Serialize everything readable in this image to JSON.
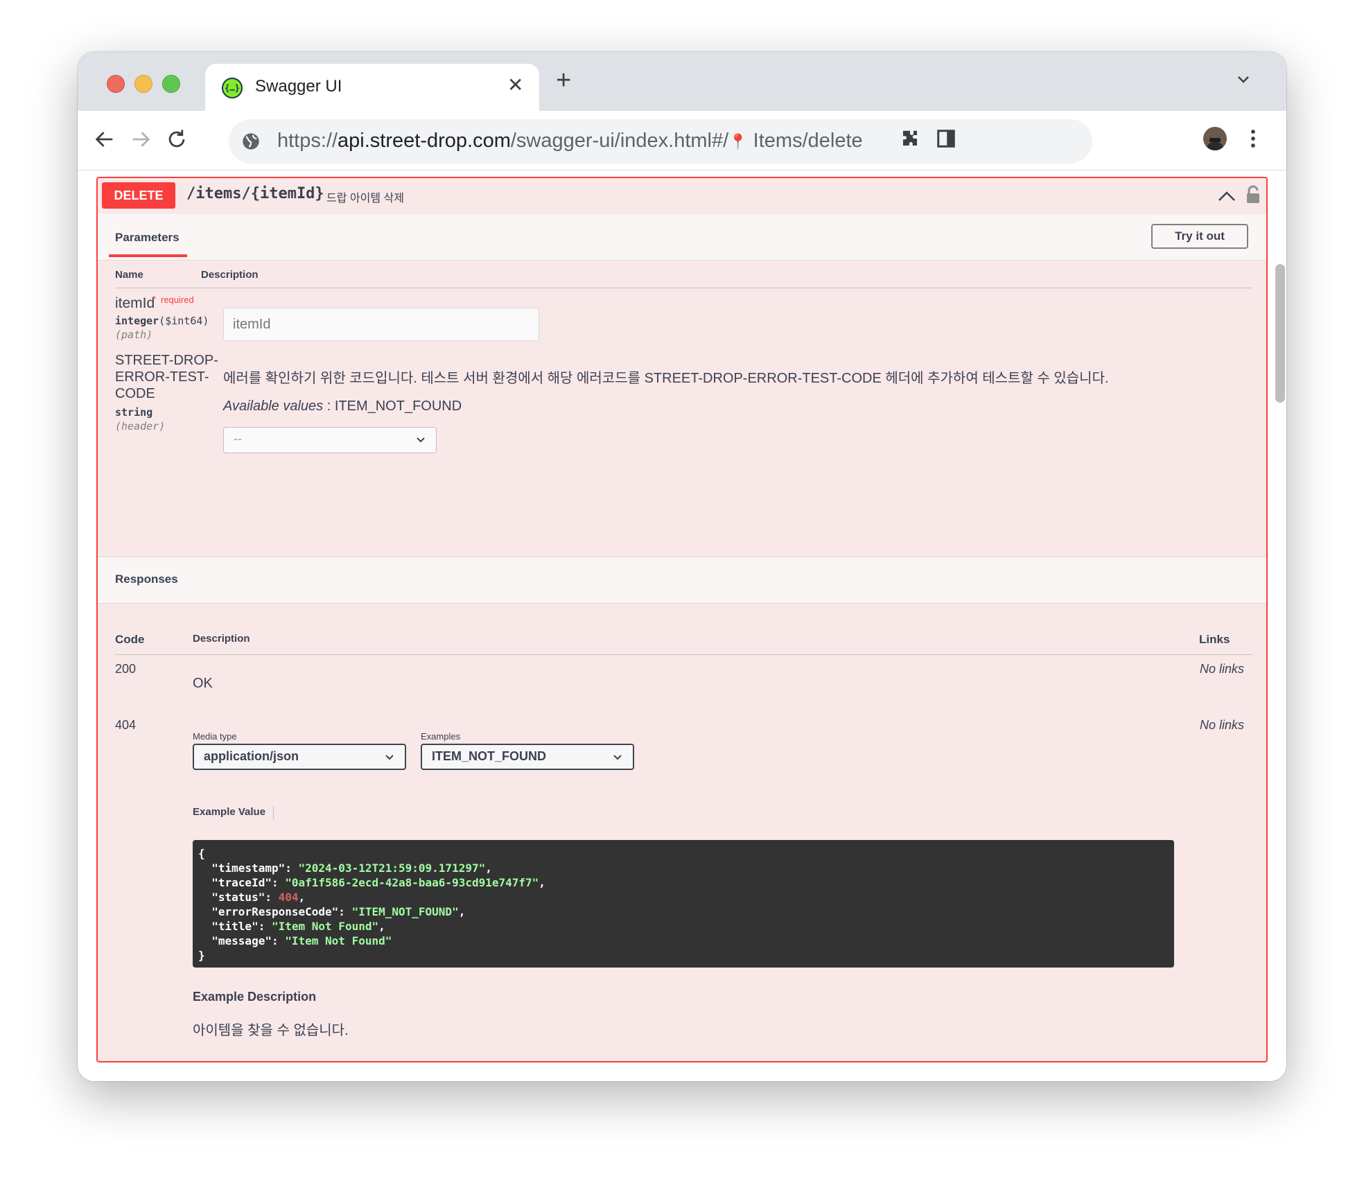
{
  "browser": {
    "tab_title": "Swagger UI",
    "tab_icon": "swagger-logo-icon",
    "url_scheme": "https://",
    "url_host": "api.street-drop.com",
    "url_path": "/swagger-ui/index.html#/",
    "url_pin_glyph": "📍",
    "url_fragment": " Items/delete"
  },
  "operation": {
    "method": "DELETE",
    "path": "/items/{itemId}",
    "summary": "드랍 아이템 삭제",
    "method_color": "#f93e3e"
  },
  "parameters_tab": "Parameters",
  "try_it_out": "Try it out",
  "params_header": {
    "name": "Name",
    "description": "Description"
  },
  "params": [
    {
      "name": "itemId",
      "required_mark": "*",
      "required_label": "required",
      "type": "integer",
      "format": "($int64)",
      "in": "(path)",
      "placeholder": "itemId"
    },
    {
      "name_lines": [
        "STREET-DROP-",
        "ERROR-TEST-",
        "CODE"
      ],
      "type": "string",
      "in": "(header)",
      "description": "에러를 확인하기 위한 코드입니다. 테스트 서버 환경에서 해당 에러코드를 STREET-DROP-ERROR-TEST-CODE 헤더에 추가하여 테스트할 수 있습니다.",
      "available_label": "Available values",
      "available_sep": " : ",
      "available_values": "ITEM_NOT_FOUND",
      "select_value": "--"
    }
  ],
  "responses_title": "Responses",
  "responses_header": {
    "code": "Code",
    "description": "Description",
    "links": "Links"
  },
  "responses": [
    {
      "code": "200",
      "description": "OK",
      "links": "No links"
    },
    {
      "code": "404",
      "links": "No links",
      "media_type_label": "Media type",
      "media_type": "application/json",
      "examples_label": "Examples",
      "example_selected": "ITEM_NOT_FOUND",
      "example_value_label": "Example Value",
      "example_json": {
        "timestamp": "2024-03-12T21:59:09.171297",
        "traceId": "0af1f586-2ecd-42a8-baa6-93cd91e747f7",
        "status": "404",
        "errorResponseCode": "ITEM_NOT_FOUND",
        "title": "Item Not Found",
        "message": "Item Not Found"
      },
      "example_description_label": "Example Description",
      "example_description": "아이템을 찾을 수 없습니다."
    }
  ]
}
